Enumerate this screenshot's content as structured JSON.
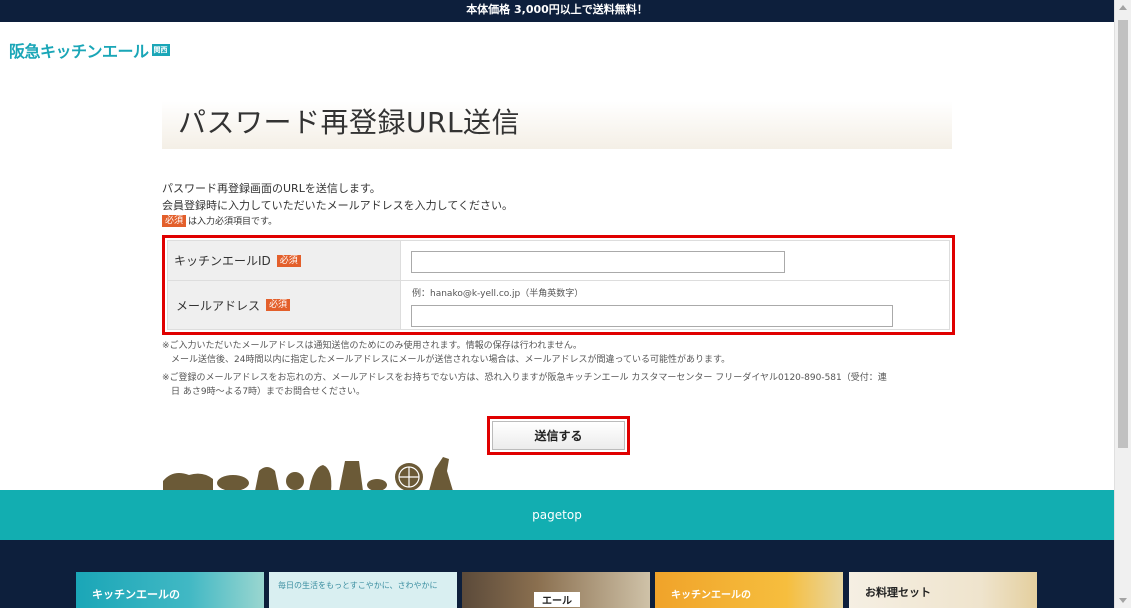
{
  "banner": {
    "text": "本体価格 3,000円以上で送料無料！"
  },
  "logo": {
    "text": "阪急キッチンエール",
    "badge": "関西"
  },
  "page": {
    "title": "パスワード再登録URL送信"
  },
  "intro": {
    "line1": "パスワード再登録画面のURLを送信します。",
    "line2": "会員登録時に入力していただいたメールアドレスを入力してください。",
    "required_badge": "必須",
    "required_note": "は入力必須項目です。"
  },
  "form": {
    "id_label": "キッチンエールID",
    "email_label": "メールアドレス",
    "required_badge": "必須",
    "id_value": "",
    "email_value": "",
    "email_example": "例：hanako@k-yell.co.jp（半角英数字）"
  },
  "notes": {
    "note1_line1": "※ご入力いただいたメールアドレスは通知送信のためにのみ使用されます。情報の保存は行われません。",
    "note1_line2": "　メール送信後、24時間以内に指定したメールアドレスにメールが送信されない場合は、メールアドレスが間違っている可能性があります。",
    "note2_line1": "※ご登録のメールアドレスをお忘れの方、メールアドレスをお持ちでない方は、恐れ入りますが阪急キッチンエール カスタマーセンター フリーダイヤル0120-890-581（受付：連",
    "note2_line2": "　日 あさ9時～よる7時）までお問合せください。"
  },
  "submit": {
    "label": "送信する"
  },
  "pagetop": {
    "label": "pagetop"
  },
  "footer_cards": [
    {
      "text": "キッチンエールの"
    },
    {
      "text": "毎日の生活をもっとすこやかに、さわやかに"
    },
    {
      "text": "エール"
    },
    {
      "text": "キッチンエールの"
    },
    {
      "text": "お料理セット"
    }
  ],
  "colors": {
    "navy": "#0d1f3c",
    "teal": "#12aeb1",
    "required": "#e35f2b",
    "highlight": "#e00000"
  }
}
